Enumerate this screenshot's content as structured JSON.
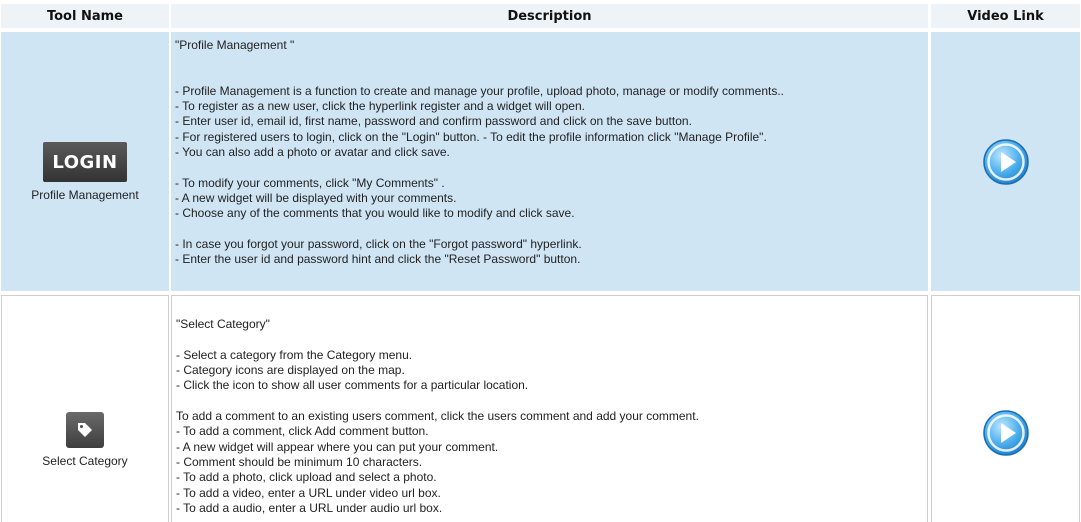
{
  "headers": {
    "tool_name": "Tool Name",
    "description": "Description",
    "video_link": "Video Link"
  },
  "rows": [
    {
      "icon": "login-icon",
      "icon_text": "LOGIN",
      "tool_name": "Profile Management",
      "lines": [
        "\"Profile Management \"",
        "",
        "",
        "- Profile Management is a function to create and manage your profile, upload photo, manage or modify comments..",
        "- To register as a new user, click the hyperlink register and a widget will open.",
        "- Enter user id, email id, first name, password and confirm password and click on the save button.",
        "- For registered users to login, click on the \"Login\" button. - To edit the profile information click \"Manage Profile\".",
        "- You can also add a photo or avatar and click save.",
        "",
        "- To modify your comments, click \"My Comments\" .",
        "- A new widget will be displayed with your comments.",
        "- Choose any of the comments that you would like to modify and click save.",
        "",
        "- In case you forgot your password, click on the \"Forgot password\" hyperlink.",
        "- Enter the user id and password hint and click the \"Reset Password\" button."
      ],
      "video_icon": "play-icon"
    },
    {
      "icon": "tag-icon",
      "tool_name": "Select Category",
      "lines": [
        "",
        "\"Select Category\"",
        "",
        "- Select a category from the Category menu.",
        "- Category icons are displayed on the map.",
        "- Click the icon to show all user comments for a particular location.",
        "",
        " To add a comment to an existing users comment, click the users comment and add your comment.",
        "- To add a comment, click Add comment button.",
        "- A new widget will appear where you can put your comment.",
        "- Comment should be minimum 10 characters.",
        "- To add a photo, click upload and select a photo.",
        "- To add a video, enter a URL under video url box.",
        "- To add a audio, enter a URL under audio url box."
      ],
      "video_icon": "play-icon"
    }
  ],
  "colors": {
    "row_highlight": "#cfe5f4",
    "header_bg": "#eef3f8",
    "play_blue": "#3aa0e8"
  }
}
